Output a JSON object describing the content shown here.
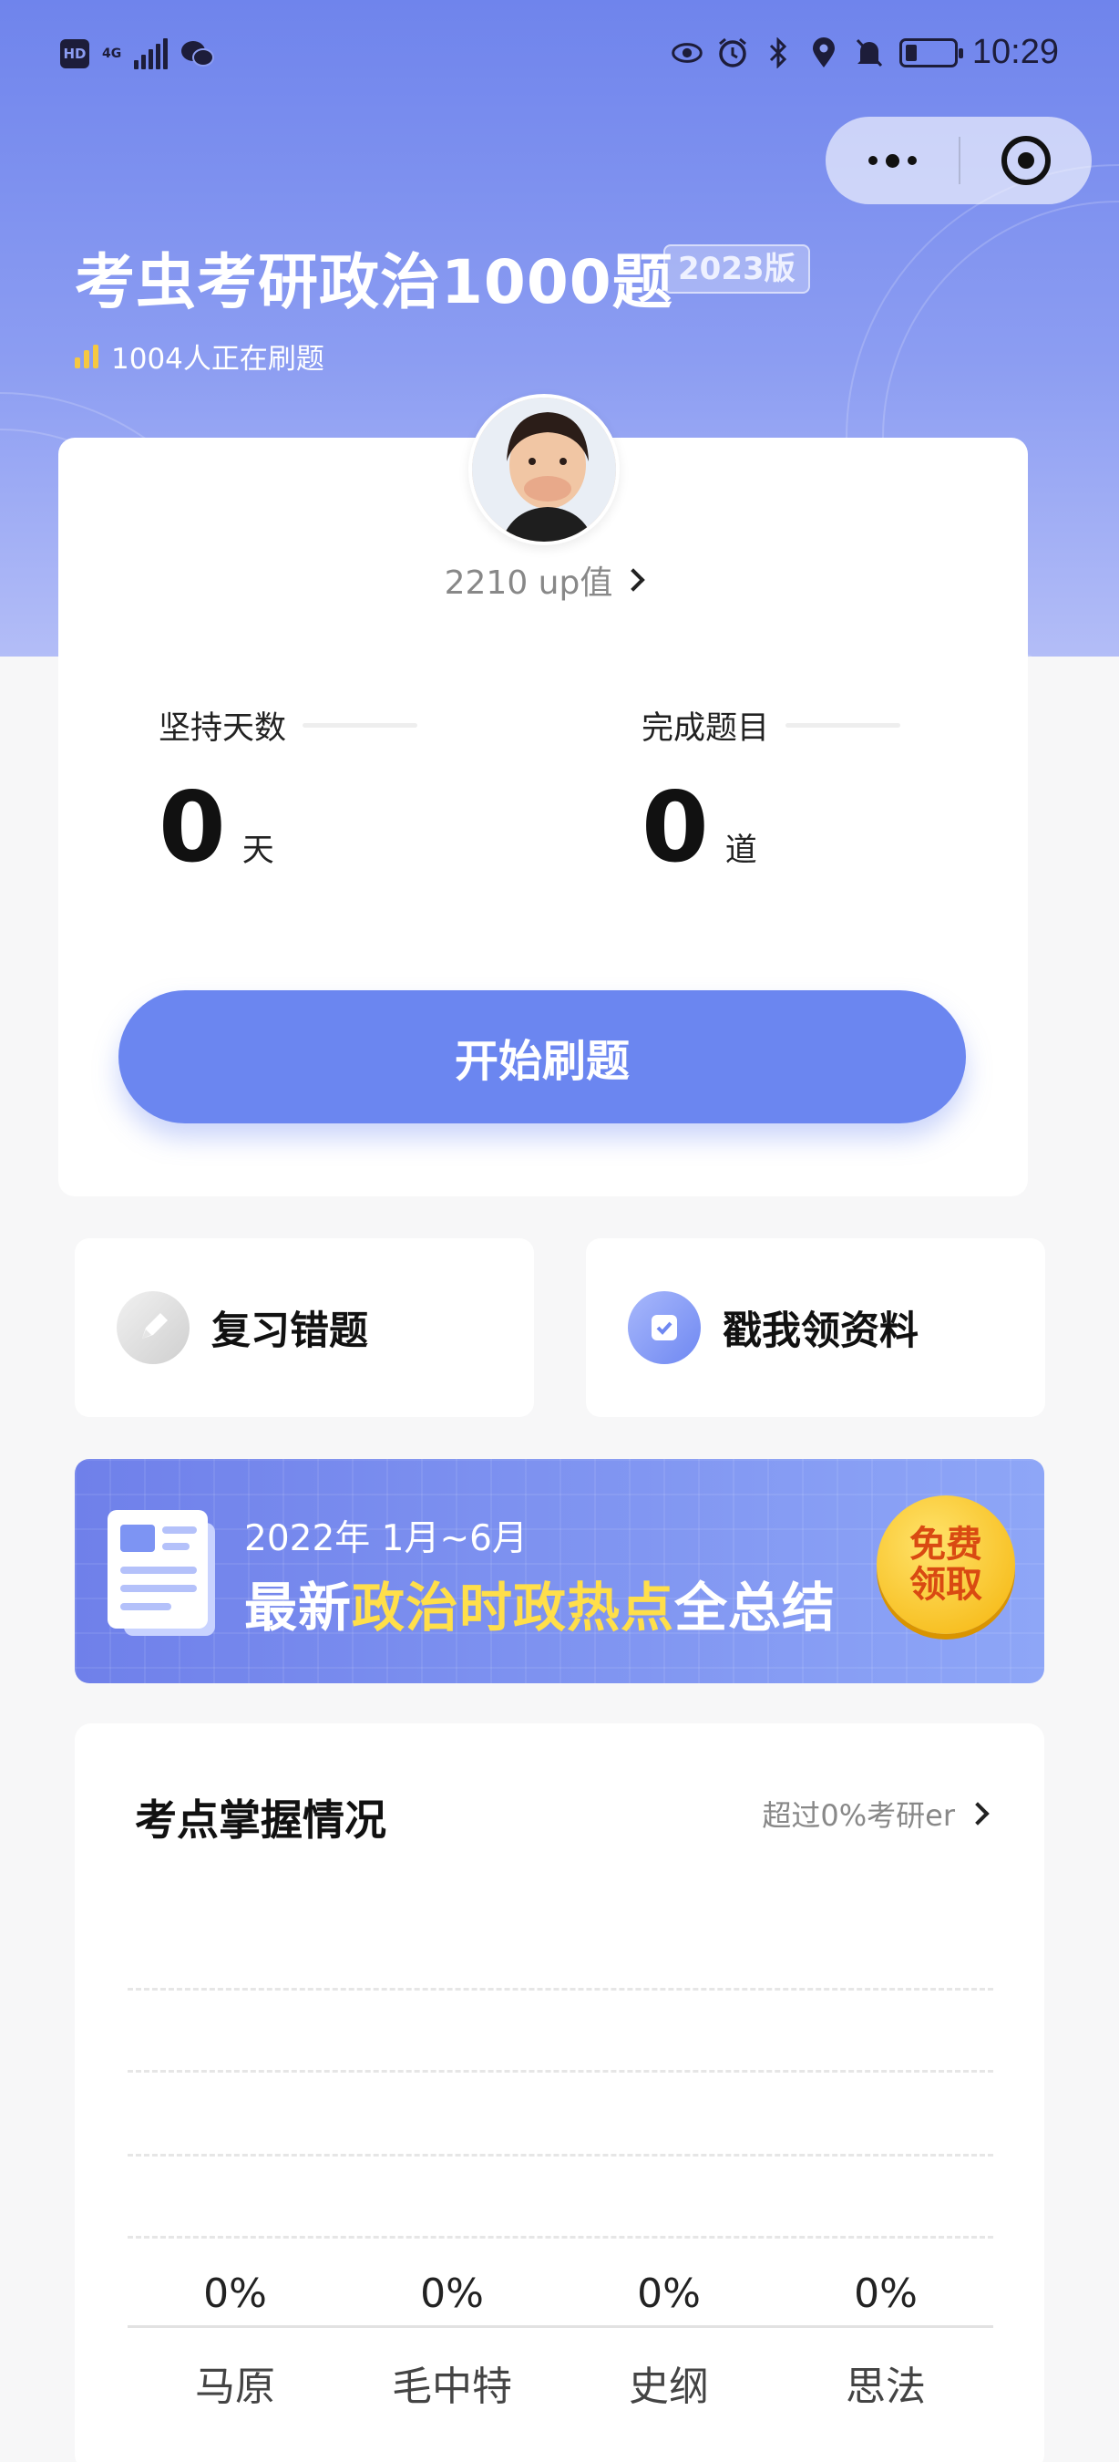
{
  "status_bar": {
    "hd": "HD",
    "network": "4G",
    "time": "10:29",
    "icons": [
      "eye-icon",
      "alarm-icon",
      "bluetooth-icon",
      "location-icon",
      "mute-icon",
      "battery-icon"
    ]
  },
  "header": {
    "title": "考虫考研政治1000题",
    "version": "2023版",
    "live_count": "1004人正在刷题"
  },
  "profile": {
    "up_value": "2210 up值"
  },
  "stats": [
    {
      "label": "坚持天数",
      "value": "0",
      "unit": "天"
    },
    {
      "label": "完成题目",
      "value": "0",
      "unit": "道"
    }
  ],
  "start_button": "开始刷题",
  "quick_actions": [
    {
      "label": "复习错题",
      "icon": "pencil-icon"
    },
    {
      "label": "戳我领资料",
      "icon": "check-icon"
    }
  ],
  "banner": {
    "line1": "2022年 1月~6月",
    "prefix": "最新",
    "highlight": "政治时政热点",
    "suffix": "全总结",
    "badge_line1": "免费",
    "badge_line2": "领取"
  },
  "mastery": {
    "title": "考点掌握情况",
    "link": "超过0%考研er",
    "columns": [
      {
        "percent": "0%",
        "label": "马原"
      },
      {
        "percent": "0%",
        "label": "毛中特"
      },
      {
        "percent": "0%",
        "label": "史纲"
      },
      {
        "percent": "0%",
        "label": "思法"
      }
    ]
  },
  "colors": {
    "primary": "#6b86f0",
    "highlight": "#ffdf4a",
    "badge": "#f5b40a"
  }
}
